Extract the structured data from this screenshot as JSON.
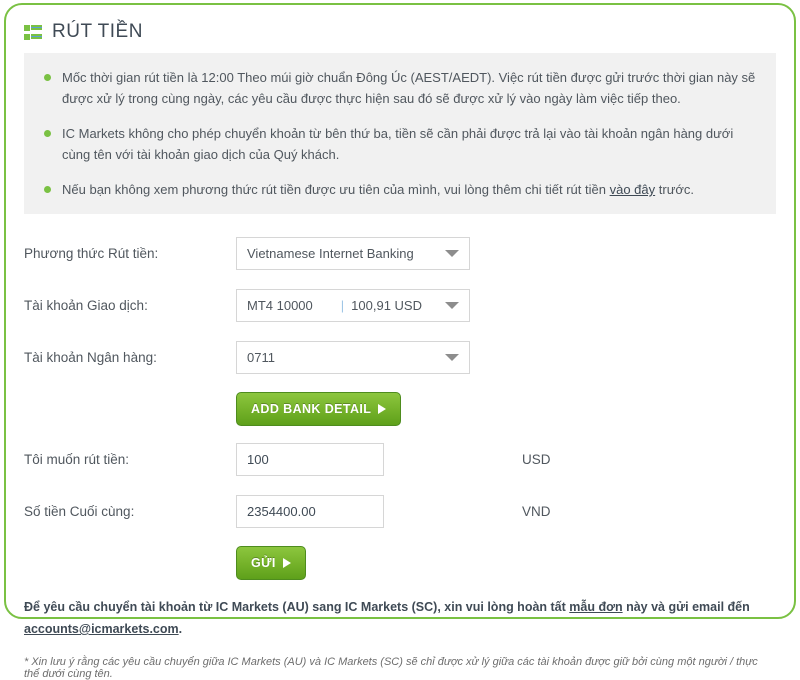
{
  "header": {
    "icon": "list-icon",
    "title": "RÚT TIỀN"
  },
  "notice": {
    "bullets": [
      "Mốc thời gian rút tiền là 12:00 Theo múi giờ chuẩn Đông Úc (AEST/AEDT). Việc rút tiền được gửi trước thời gian này sẽ được xử lý trong cùng ngày, các yêu cầu được thực hiện sau đó sẽ được xử lý vào ngày làm việc tiếp theo.",
      "IC Markets không cho phép chuyển khoản từ bên thứ ba, tiền sẽ cần phải được trả lại vào tài khoản ngân hàng dưới cùng tên với tài khoản giao dịch của Quý khách."
    ],
    "bullet3_before": "Nếu bạn không xem phương thức rút tiền được ưu tiên của mình, vui lòng thêm chi tiết rút tiền ",
    "bullet3_link": "vào đây",
    "bullet3_after": " trước."
  },
  "form": {
    "method_label": "Phương thức Rút tiền:",
    "method_value": "Vietnamese Internet Banking",
    "trading_account_label": "Tài khoản Giao dịch:",
    "trading_account_name": "MT4 10000",
    "trading_account_sep": "|",
    "trading_account_balance": "100,91 USD",
    "bank_account_label": "Tài khoản Ngân hàng:",
    "bank_account_value": "0711",
    "add_bank_button": "ADD BANK DETAIL",
    "amount_label": "Tôi muốn rút tiền:",
    "amount_value": "100",
    "amount_currency": "USD",
    "final_label": "Số tiền Cuối cùng:",
    "final_value": "2354400.00",
    "final_currency": "VND",
    "submit_button": "GỬI"
  },
  "footer": {
    "note_before": "Để yêu cầu chuyển tài khoản từ IC Markets (AU) sang IC Markets (SC), xin vui lòng hoàn tất ",
    "note_link": "mẫu đơn",
    "note_middle": " này và gửi email đến ",
    "note_email": "accounts@icmarkets.com",
    "note_after": ".",
    "fineprint": "* Xin lưu ý rằng các yêu cầu chuyển giữa IC Markets (AU) và IC Markets (SC) sẽ chỉ được xử lý giữa các tài khoản được giữ bởi cùng một người / thực thể dưới cùng tên."
  },
  "colors": {
    "brand_green": "#7ac143",
    "button_green": "#76b32b",
    "notice_bg": "#f1f1f1",
    "text": "#50575e"
  }
}
